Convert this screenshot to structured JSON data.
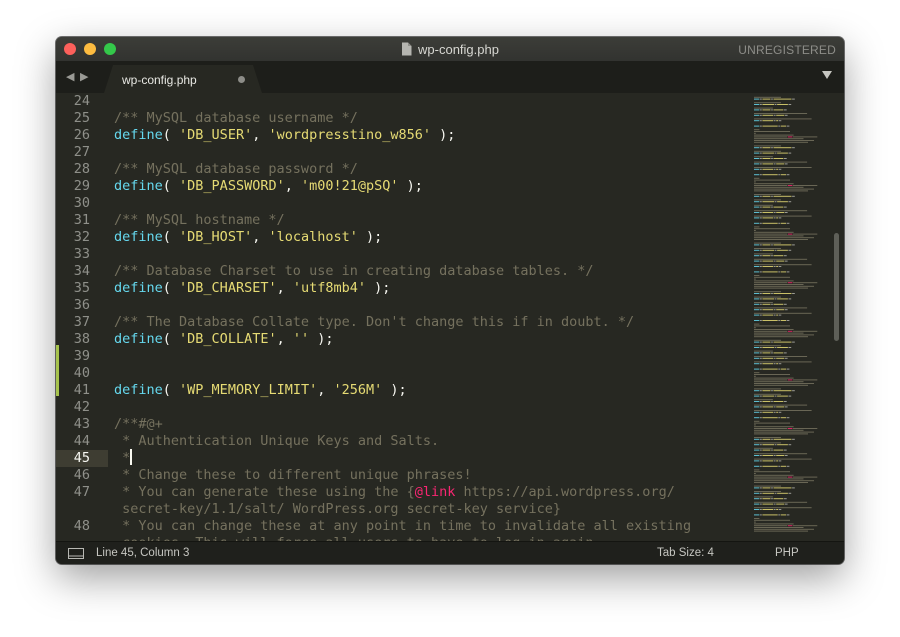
{
  "window": {
    "title": "wp-config.php",
    "license_status": "UNREGISTERED"
  },
  "tabs": {
    "active_tab_label": "wp-config.php"
  },
  "editor": {
    "lines": [
      {
        "num": "24",
        "segs": []
      },
      {
        "num": "25",
        "segs": [
          {
            "t": "/** MySQL database username */",
            "c": "c"
          }
        ]
      },
      {
        "num": "26",
        "segs": [
          {
            "t": "define",
            "c": "k"
          },
          {
            "t": "( ",
            "c": "p"
          },
          {
            "t": "'DB_USER'",
            "c": "s"
          },
          {
            "t": ", ",
            "c": "p"
          },
          {
            "t": "'wordpresstino_w856'",
            "c": "s"
          },
          {
            "t": " );",
            "c": "p"
          }
        ]
      },
      {
        "num": "27",
        "segs": []
      },
      {
        "num": "28",
        "segs": [
          {
            "t": "/** MySQL database password */",
            "c": "c"
          }
        ]
      },
      {
        "num": "29",
        "segs": [
          {
            "t": "define",
            "c": "k"
          },
          {
            "t": "( ",
            "c": "p"
          },
          {
            "t": "'DB_PASSWORD'",
            "c": "s"
          },
          {
            "t": ", ",
            "c": "p"
          },
          {
            "t": "'m00!21@pSQ'",
            "c": "s"
          },
          {
            "t": " );",
            "c": "p"
          }
        ]
      },
      {
        "num": "30",
        "segs": []
      },
      {
        "num": "31",
        "segs": [
          {
            "t": "/** MySQL hostname */",
            "c": "c"
          }
        ]
      },
      {
        "num": "32",
        "segs": [
          {
            "t": "define",
            "c": "k"
          },
          {
            "t": "( ",
            "c": "p"
          },
          {
            "t": "'DB_HOST'",
            "c": "s"
          },
          {
            "t": ", ",
            "c": "p"
          },
          {
            "t": "'localhost'",
            "c": "s"
          },
          {
            "t": " );",
            "c": "p"
          }
        ]
      },
      {
        "num": "33",
        "segs": []
      },
      {
        "num": "34",
        "segs": [
          {
            "t": "/** Database Charset to use in creating database tables. */",
            "c": "c"
          }
        ]
      },
      {
        "num": "35",
        "segs": [
          {
            "t": "define",
            "c": "k"
          },
          {
            "t": "( ",
            "c": "p"
          },
          {
            "t": "'DB_CHARSET'",
            "c": "s"
          },
          {
            "t": ", ",
            "c": "p"
          },
          {
            "t": "'utf8mb4'",
            "c": "s"
          },
          {
            "t": " );",
            "c": "p"
          }
        ]
      },
      {
        "num": "36",
        "segs": []
      },
      {
        "num": "37",
        "segs": [
          {
            "t": "/** The Database Collate type. Don't change this if in doubt. */",
            "c": "c"
          }
        ]
      },
      {
        "num": "38",
        "segs": [
          {
            "t": "define",
            "c": "k"
          },
          {
            "t": "( ",
            "c": "p"
          },
          {
            "t": "'DB_COLLATE'",
            "c": "s"
          },
          {
            "t": ", ",
            "c": "p"
          },
          {
            "t": "''",
            "c": "s"
          },
          {
            "t": " );",
            "c": "p"
          }
        ]
      },
      {
        "num": "39",
        "segs": []
      },
      {
        "num": "40",
        "segs": []
      },
      {
        "num": "41",
        "segs": [
          {
            "t": "define",
            "c": "k"
          },
          {
            "t": "( ",
            "c": "p"
          },
          {
            "t": "'WP_MEMORY_LIMIT'",
            "c": "s"
          },
          {
            "t": ", ",
            "c": "p"
          },
          {
            "t": "'256M'",
            "c": "s"
          },
          {
            "t": " );",
            "c": "p"
          }
        ]
      },
      {
        "num": "42",
        "segs": []
      },
      {
        "num": "43",
        "segs": [
          {
            "t": "/**#@+",
            "c": "c"
          }
        ]
      },
      {
        "num": "44",
        "segs": [
          {
            "t": " * Authentication Unique Keys and Salts.",
            "c": "c"
          }
        ]
      },
      {
        "num": "45",
        "segs": [
          {
            "t": " *",
            "c": "c"
          }
        ]
      },
      {
        "num": "46",
        "segs": [
          {
            "t": " * Change these to different unique phrases!",
            "c": "c"
          }
        ]
      },
      {
        "num": "47",
        "segs": [
          {
            "t": " * You can generate these using the {",
            "c": "c"
          },
          {
            "t": "@link",
            "c": "tag"
          },
          {
            "t": " https://api.wordpress.org/",
            "c": "c"
          }
        ]
      },
      {
        "num": "",
        "segs": [
          {
            "t": " secret-key/1.1/salt/ WordPress.org secret-key service}",
            "c": "c"
          }
        ]
      },
      {
        "num": "48",
        "segs": [
          {
            "t": " * You can change these at any point in time to invalidate all existing",
            "c": "c"
          }
        ]
      },
      {
        "num": "",
        "segs": [
          {
            "t": " cookies. This will force all users to have to log in again.",
            "c": "c"
          }
        ]
      }
    ],
    "active_line_number": "45",
    "modified_line_numbers": [
      "39",
      "40",
      "41"
    ]
  },
  "status": {
    "position": "Line 45, Column 3",
    "tab_size": "Tab Size: 4",
    "syntax": "PHP"
  },
  "theme": {
    "background": "#272822",
    "comment": "#75715e",
    "keyword": "#66d9ef",
    "string": "#e6db74",
    "tag": "#f92672",
    "modified_marker": "#a6c24d"
  }
}
